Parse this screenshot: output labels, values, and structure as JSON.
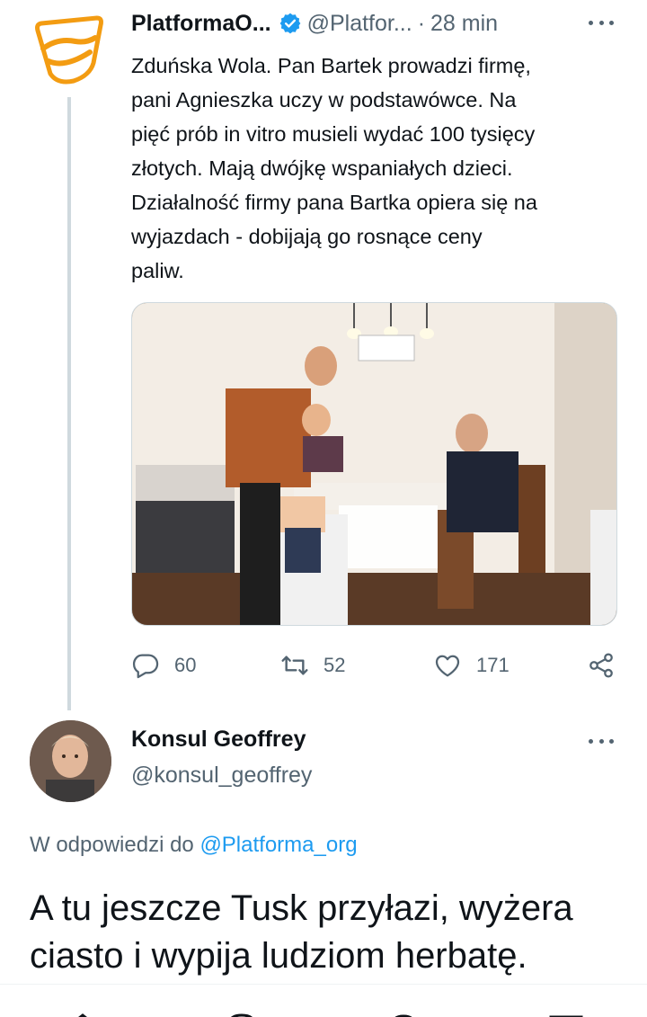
{
  "tweet": {
    "author_name": "PlatformaO...",
    "handle": "@Platfor...",
    "separator": "·",
    "time": "28 min",
    "text": "Zduńska Wola. Pan Bartek prowadzi firmę,\npani Agnieszka uczy w podstawówce. Na\npięć prób in vitro musieli wydać 100 tysięcy\nzłotych. Mają dwójkę wspaniałych dzieci.\nDziałalność firmy pana Bartka opiera się na\nwyjazdach - dobijają go rosnące ceny\npaliw.",
    "replies": "60",
    "retweets": "52",
    "likes": "171"
  },
  "reply": {
    "author_name": "Konsul Geoffrey",
    "handle": "@konsul_geoffrey",
    "replying_prefix": "W odpowiedzi do",
    "replying_mention": "@Platforma_org",
    "text": "A tu jeszcze Tusk przyłazi, wyżera ciasto i wypija ludziom herbatę."
  },
  "colors": {
    "accent": "#1d9bf0",
    "text_primary": "#0f1419",
    "text_secondary": "#536471",
    "logo_orange": "#f39c12"
  },
  "icons": {
    "reply": "speech-bubble-icon",
    "retweet": "retweet-icon",
    "like": "heart-icon",
    "share": "share-icon",
    "verified": "verified-badge-icon",
    "more": "more-dots-icon"
  }
}
